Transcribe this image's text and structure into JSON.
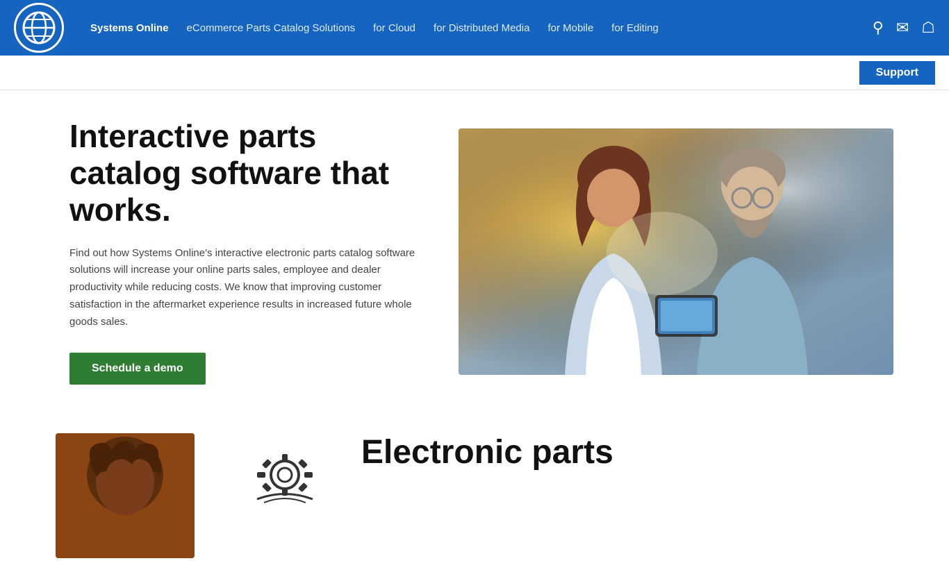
{
  "navbar": {
    "logo_alt": "Systems Online Logo",
    "links": [
      {
        "label": "Systems Online",
        "active": true
      },
      {
        "label": "eCommerce Parts Catalog Solutions",
        "active": false
      },
      {
        "label": "for Cloud",
        "active": false
      },
      {
        "label": "for Distributed Media",
        "active": false
      },
      {
        "label": "for Mobile",
        "active": false
      },
      {
        "label": "for Editing",
        "active": false
      }
    ],
    "icons": [
      "search",
      "mail",
      "user"
    ]
  },
  "support_bar": {
    "button_label": "Support"
  },
  "hero": {
    "title": "Interactive parts catalog software that works.",
    "description": "Find out how Systems Online's interactive electronic parts catalog software solutions will increase your online parts sales, employee and dealer productivity while reducing costs. We know that improving customer satisfaction in the aftermarket experience results in increased future whole goods sales.",
    "cta_label": "Schedule a demo"
  },
  "bottom": {
    "title": "Electronic parts"
  }
}
